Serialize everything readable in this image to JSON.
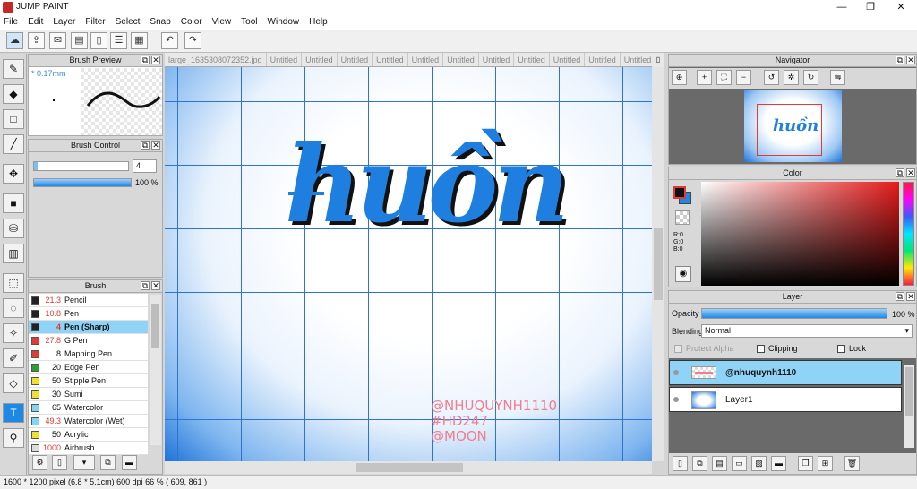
{
  "app": {
    "title": "JUMP PAINT"
  },
  "window_controls": {
    "minimize": "—",
    "maximize": "❐",
    "close": "✕"
  },
  "menu": [
    "File",
    "Edit",
    "Layer",
    "Filter",
    "Select",
    "Snap",
    "Color",
    "View",
    "Tool",
    "Window",
    "Help"
  ],
  "tabs": {
    "items": [
      "large_1635308072352.jpg",
      "Untitled",
      "Untitled",
      "Untitled",
      "Untitled",
      "Untitled",
      "Untitled",
      "Untitled",
      "Untitled",
      "Untitled",
      "Untitled",
      "Untitled",
      "Untitled",
      "Untitled"
    ],
    "active_index": 13
  },
  "brush_preview": {
    "title": "Brush Preview",
    "size": "* 0.17mm"
  },
  "brush_control": {
    "title": "Brush Control",
    "size_value": "4",
    "opacity_label": "100 %"
  },
  "brush_list": {
    "title": "Brush",
    "items": [
      {
        "size": "21.3",
        "name": "Pencil",
        "color": "#222222",
        "size_color": "#e53935"
      },
      {
        "size": "10.8",
        "name": "Pen",
        "color": "#222222",
        "size_color": "#e53935"
      },
      {
        "size": "4",
        "name": "Pen (Sharp)",
        "color": "#222222",
        "size_color": "#e53935"
      },
      {
        "size": "27.8",
        "name": "G Pen",
        "color": "#e53935",
        "size_color": "#e53935"
      },
      {
        "size": "8",
        "name": "Mapping Pen",
        "color": "#e53935",
        "size_color": "#111111"
      },
      {
        "size": "20",
        "name": "Edge Pen",
        "color": "#2e9e2e",
        "size_color": "#111111"
      },
      {
        "size": "50",
        "name": "Stipple Pen",
        "color": "#f0e030",
        "size_color": "#111111"
      },
      {
        "size": "30",
        "name": "Sumi",
        "color": "#f0e030",
        "size_color": "#111111"
      },
      {
        "size": "65",
        "name": "Watercolor",
        "color": "#7fd6f5",
        "size_color": "#111111"
      },
      {
        "size": "49.3",
        "name": "Watercolor (Wet)",
        "color": "#7fd6f5",
        "size_color": "#e53935"
      },
      {
        "size": "50",
        "name": "Acrylic",
        "color": "#f0e030",
        "size_color": "#111111"
      },
      {
        "size": "1000",
        "name": "Airbrush",
        "color": "#dddddd",
        "size_color": "#e53935"
      }
    ],
    "selected_index": 2
  },
  "canvas": {
    "main_text": "huồn",
    "signature": [
      "@NHUQUYNH1110",
      "#HD247",
      "@MOON"
    ]
  },
  "navigator": {
    "title": "Navigator"
  },
  "color_panel": {
    "title": "Color",
    "r": "R:0",
    "g": "G:0",
    "b": "B:0",
    "fg": "#111111",
    "bg": "#1e88e5"
  },
  "layer_panel": {
    "title": "Layer",
    "opacity_label": "Opacity",
    "opacity_value": "100 %",
    "blending_label": "Blending",
    "blending_value": "Normal",
    "protect_alpha": "Protect Alpha",
    "clipping": "Clipping",
    "lock": "Lock",
    "layers": [
      {
        "name": "@nhuquynh1110",
        "selected": true
      },
      {
        "name": "Layer1",
        "selected": false
      }
    ]
  },
  "status": {
    "text": "1600 * 1200 pixel   (6.8 * 5.1cm)   600 dpi   66 %   ( 609, 861 )"
  },
  "colors": {
    "accent": "#1e88e5",
    "grid": "#2f73d2",
    "selection": "#8fd3f7"
  }
}
